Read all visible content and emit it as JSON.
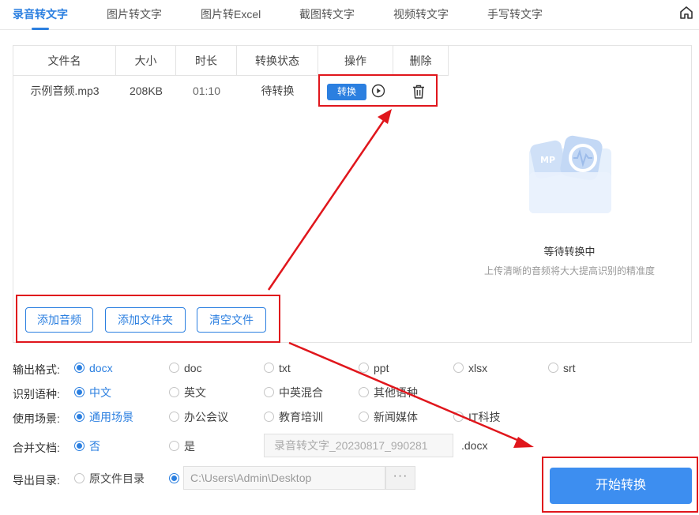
{
  "tabs": [
    {
      "label": "录音转文字",
      "active": true
    },
    {
      "label": "图片转文字",
      "active": false
    },
    {
      "label": "图片转Excel",
      "active": false
    },
    {
      "label": "截图转文字",
      "active": false
    },
    {
      "label": "视频转文字",
      "active": false
    },
    {
      "label": "手写转文字",
      "active": false
    }
  ],
  "table": {
    "headers": [
      "文件名",
      "大小",
      "时长",
      "转换状态",
      "操作",
      "删除"
    ],
    "rows": [
      {
        "name": "示例音频.mp3",
        "size": "208KB",
        "duration": "01:10",
        "status": "待转换",
        "action_label": "转换"
      }
    ]
  },
  "file_buttons": [
    "添加音频",
    "添加文件夹",
    "清空文件"
  ],
  "status_panel": {
    "title": "等待转换中",
    "subtitle": "上传清晰的音频将大大提高识别的精准度",
    "illustration_label": "MP"
  },
  "settings": {
    "format": {
      "label": "输出格式:",
      "options": [
        "docx",
        "doc",
        "txt",
        "ppt",
        "xlsx",
        "srt"
      ],
      "selected": "docx"
    },
    "language": {
      "label": "识别语种:",
      "options": [
        "中文",
        "英文",
        "中英混合",
        "其他语种"
      ],
      "selected": "中文"
    },
    "scene": {
      "label": "使用场景:",
      "options": [
        "通用场景",
        "办公会议",
        "教育培训",
        "新闻媒体",
        "IT科技"
      ],
      "selected": "通用场景"
    },
    "merge": {
      "label": "合并文档:",
      "options": [
        "否",
        "是"
      ],
      "selected": "否",
      "filename": "录音转文字_20230817_990281",
      "suffix": ".docx"
    },
    "export": {
      "label": "导出目录:",
      "options": [
        "原文件目录"
      ],
      "custom_selected": true,
      "path": "C:\\Users\\Admin\\Desktop",
      "more": "···"
    }
  },
  "start_button": "开始转换",
  "colors": {
    "accent": "#2b7fe0",
    "annotation": "#e0161c",
    "start": "#3d8ef0"
  }
}
